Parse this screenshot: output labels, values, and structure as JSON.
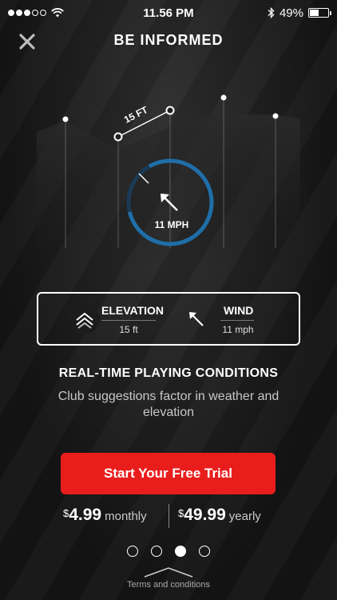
{
  "status": {
    "time": "11.56 PM",
    "battery": "49%",
    "battery_level": 0.49,
    "signal_bars_filled": 3,
    "signal_bars_total": 5
  },
  "header": {
    "title": "BE INFORMED",
    "close_icon": "close-icon"
  },
  "hero": {
    "distance_label": "15 FT",
    "wind_speed": "11 MPH",
    "ring_color": "#1f6ea8"
  },
  "conditions": {
    "elevation": {
      "label": "ELEVATION",
      "value": "15 ft",
      "icon": "elevation-chevrons-icon"
    },
    "wind": {
      "label": "WIND",
      "value": "11 mph",
      "icon": "wind-arrow-icon"
    }
  },
  "headline": "REAL-TIME PLAYING CONDITIONS",
  "subtext": "Club suggestions factor in weather and elevation",
  "cta": {
    "label": "Start Your Free Trial",
    "color": "#ea1d1d"
  },
  "pricing": {
    "monthly": {
      "currency": "$",
      "amount": "4.99",
      "period": "monthly"
    },
    "yearly": {
      "currency": "$",
      "amount": "49.99",
      "period": "yearly"
    }
  },
  "pager": {
    "count": 4,
    "active": 2
  },
  "footer": {
    "terms_label": "Terms and conditions"
  }
}
